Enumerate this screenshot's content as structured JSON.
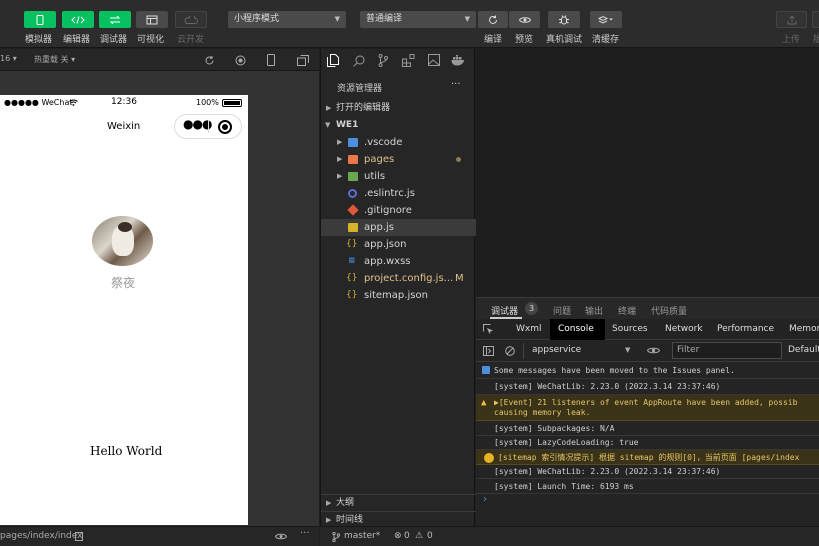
{
  "toolbar": {
    "simulator": "模拟器",
    "editor": "编辑器",
    "debugger": "调试器",
    "visual": "可视化",
    "cloud": "云开发",
    "mode_select": "小程序模式",
    "compile_select": "普通编译",
    "compile": "编译",
    "preview": "预览",
    "real_debug": "真机调试",
    "clear_cache": "清缓存",
    "upload": "上传",
    "version_cut": "版"
  },
  "simulator": {
    "device_fragment": "16",
    "hot_reload": "热重载 关",
    "status_carrier": "●●●●● WeChat",
    "status_time": "12:36",
    "status_battery": "100%",
    "nav_title": "Weixin",
    "username": "祭夜",
    "hello": "Hello World",
    "path": "pages/index/index"
  },
  "explorer": {
    "title": "资源管理器",
    "more": "···",
    "open_editors": "打开的编辑器",
    "root": "WE1",
    "files": [
      {
        "name": ".vscode"
      },
      {
        "name": "pages"
      },
      {
        "name": "utils"
      },
      {
        "name": ".eslintrc.js"
      },
      {
        "name": ".gitignore"
      },
      {
        "name": "app.js"
      },
      {
        "name": "app.json"
      },
      {
        "name": "app.wxss"
      },
      {
        "name": "project.config.js...",
        "badge": "M"
      },
      {
        "name": "sitemap.json"
      }
    ],
    "outline": "大纲",
    "timeline": "时间线"
  },
  "statusbar": {
    "branch": "master*",
    "errors": "0",
    "warnings": "0"
  },
  "devtools": {
    "tabs": [
      "调试器",
      "问题",
      "输出",
      "终端",
      "代码质量"
    ],
    "debugger_count": "3",
    "subtabs": [
      "Wxml",
      "Console",
      "Sources",
      "Network",
      "Performance",
      "Memor"
    ],
    "context": "appservice",
    "filter_placeholder": "Filter",
    "levels": "Default",
    "console": [
      "Some messages have been moved to the Issues panel.",
      "[system] WeChatLib: 2.23.0 (2022.3.14 23:37:46)",
      "▶[Event] 21 listeners of event AppRoute have been added, possib",
      "causing memory leak.",
      "[system] Subpackages: N/A",
      "[system] LazyCodeLoading: true",
      "[sitemap 索引情况提示] 根据 sitemap 的规则[0]，当前页面 [pages/index",
      "[system] WeChatLib: 2.23.0 (2022.3.14 23:37:46)",
      "[system] Launch Time: 6193 ms"
    ],
    "prompt": "›"
  },
  "colors": {
    "accent": "#07c160",
    "warning": "#e6c56a"
  }
}
